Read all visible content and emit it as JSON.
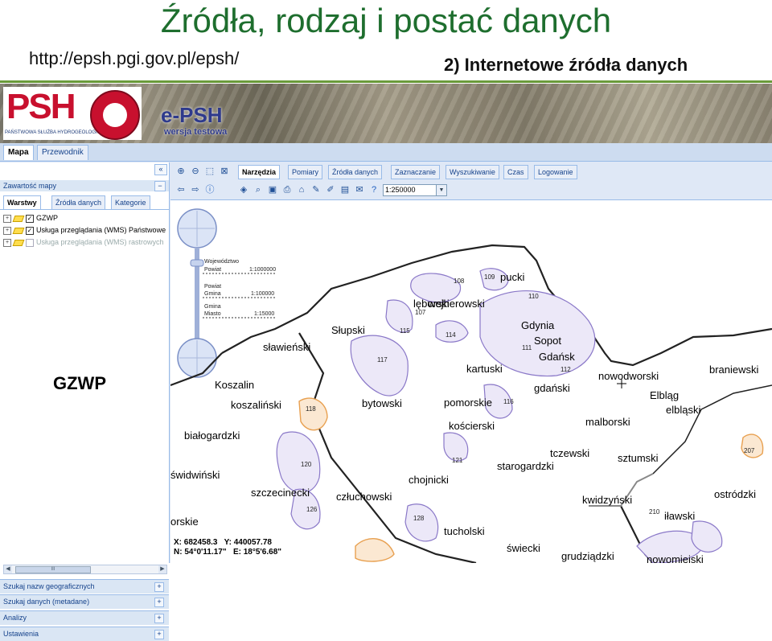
{
  "slide": {
    "title": "Źródła, rodzaj i postać danych",
    "url": "http://epsh.pgi.gov.pl/epsh/",
    "subtitle": "2) Internetowe źródła danych"
  },
  "banner": {
    "logo_text": "PSH",
    "logo_subtext": "PAŃSTWOWA SŁUŻBA HYDROGEOLOGICZNA",
    "app_name": "e-PSH",
    "app_subname": "wersja testowa"
  },
  "main_tabs": [
    "Mapa",
    "Przewodnik"
  ],
  "left_panel": {
    "header": "Zawartość mapy",
    "tabs": [
      "Warstwy",
      "Źródła danych",
      "Kategorie"
    ],
    "layers": [
      {
        "label": "GZWP",
        "checked": true
      },
      {
        "label": "Usługa przeglądania (WMS) Państwowe",
        "checked": true
      },
      {
        "label": "Usługa przeglądania (WMS) rastrowych",
        "checked": false
      }
    ],
    "overlay_label": "GZWP",
    "scroll_label": "III",
    "accordion": [
      "Szukaj nazw geograficznych",
      "Szukaj danych (metadane)",
      "Analizy",
      "Ustawienia"
    ]
  },
  "toolbar": {
    "tabs": [
      "Narzędzia",
      "Pomiary",
      "Źródła danych",
      "Zaznaczanie",
      "Wyszukiwanie",
      "Czas",
      "Logowanie"
    ],
    "active_tab": "Narzędzia",
    "scale_value": "1:250000",
    "icons_row1": [
      "zoom-in-icon",
      "zoom-out-icon",
      "zoom-box-icon",
      "full-extent-icon"
    ],
    "icons_row2": [
      "back-icon",
      "forward-icon",
      "info-icon",
      "layers-icon",
      "search-map-icon",
      "save-icon",
      "print-icon",
      "home-icon",
      "draw-icon",
      "edit-icon",
      "legend-icon",
      "email-icon",
      "help-icon",
      "scale-icon"
    ]
  },
  "zoom_scale": {
    "labels": [
      "Województwo",
      "Powiat",
      "1:1000000",
      "Powiat",
      "Gmina",
      "1:100000",
      "Gmina",
      "Miasto",
      "1:15000"
    ]
  },
  "map": {
    "labels": [
      {
        "text": "pucki"
      },
      {
        "text": "wejherowski"
      },
      {
        "text": "lęborski"
      },
      {
        "text": "Słupski"
      },
      {
        "text": "Gdynia"
      },
      {
        "text": "Sopot"
      },
      {
        "text": "Gdańsk"
      },
      {
        "text": "kartuski"
      },
      {
        "text": "gdański"
      },
      {
        "text": "nowodworski"
      },
      {
        "text": "braniewski"
      },
      {
        "text": "Elbląg"
      },
      {
        "text": "elbląski"
      },
      {
        "text": "sławieński"
      },
      {
        "text": "Koszalin"
      },
      {
        "text": "koszaliński"
      },
      {
        "text": "bytowski"
      },
      {
        "text": "pomorskie"
      },
      {
        "text": "kościerski"
      },
      {
        "text": "malborski"
      },
      {
        "text": "białogardzki"
      },
      {
        "text": "tczewski"
      },
      {
        "text": "starogardzki"
      },
      {
        "text": "sztumski"
      },
      {
        "text": "świdwiński"
      },
      {
        "text": "szczecinecki"
      },
      {
        "text": "człuchowski"
      },
      {
        "text": "chojnicki"
      },
      {
        "text": "kwidzyński"
      },
      {
        "text": "iławski"
      },
      {
        "text": "ostródzki"
      },
      {
        "text": "tucholski"
      },
      {
        "text": "świecki"
      },
      {
        "text": "grudziądzki"
      },
      {
        "text": "orskie"
      },
      {
        "text": "nowomiejski"
      }
    ],
    "basin_numbers": [
      "108",
      "109",
      "110",
      "107",
      "115",
      "114",
      "111",
      "112",
      "117",
      "116",
      "118",
      "121",
      "120",
      "126",
      "128",
      "210",
      "207"
    ],
    "coords": {
      "x": "X: 682458.3",
      "y": "Y: 440057.78",
      "n": "N: 54°0'11.17\"",
      "e": "E: 18°5'6.68\""
    }
  },
  "colors": {
    "title_green": "#1e6e2e",
    "basin_fill": "#ece8f8",
    "basin_stroke": "#8a78c8",
    "alt_basin": "#e8a050",
    "ui_blue": "#15428b"
  }
}
